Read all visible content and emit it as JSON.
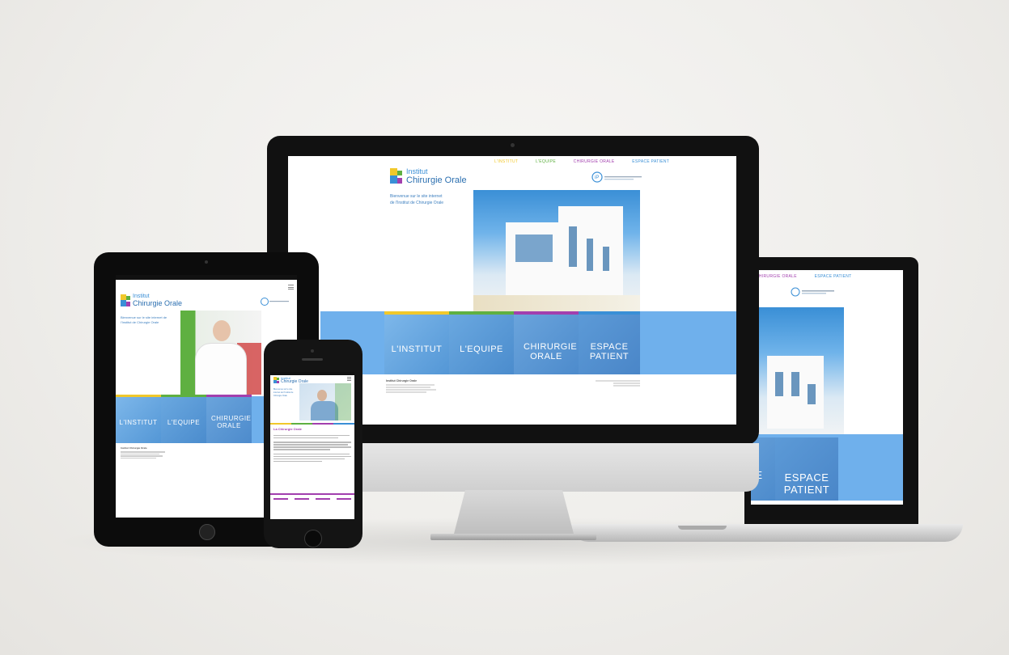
{
  "site": {
    "logo_line1": "Institut",
    "logo_line2": "Chirurgie Orale",
    "nav": [
      "L'INSTITUT",
      "L'EQUIPE",
      "CHIRURGIE ORALE",
      "ESPACE PATIENT"
    ],
    "tiles": [
      "L'INSTITUT",
      "L'EQUIPE",
      "CHIRURGIE ORALE",
      "ESPACE PATIENT"
    ],
    "intro": "Bienvenue sur le site internet de l'Institut de Chirurgie Orale",
    "footer_name": "Institut Chirurgie Orale"
  },
  "laptop": {
    "nav": [
      "CHIRURGIE ORALE",
      "ESPACE PATIENT"
    ],
    "tiles": [
      "E",
      "ESPACE PATIENT"
    ]
  },
  "ipad": {
    "tiles": [
      "L'INSTITUT",
      "L'EQUIPE",
      "CHIRURGIE ORALE"
    ]
  },
  "phone": {
    "heading": "La Chirurgie Orale"
  },
  "colors": {
    "accent_blue": "#3a8fd6",
    "tile_blue": "#6fb0ec",
    "yellow": "#f1c82b",
    "green": "#5fb041",
    "purple": "#a23fae",
    "background": "#efeeeb"
  },
  "icons": [
    "apple-logo-icon",
    "ipad-home-button-icon",
    "iphone-home-button-icon",
    "menu-icon"
  ]
}
